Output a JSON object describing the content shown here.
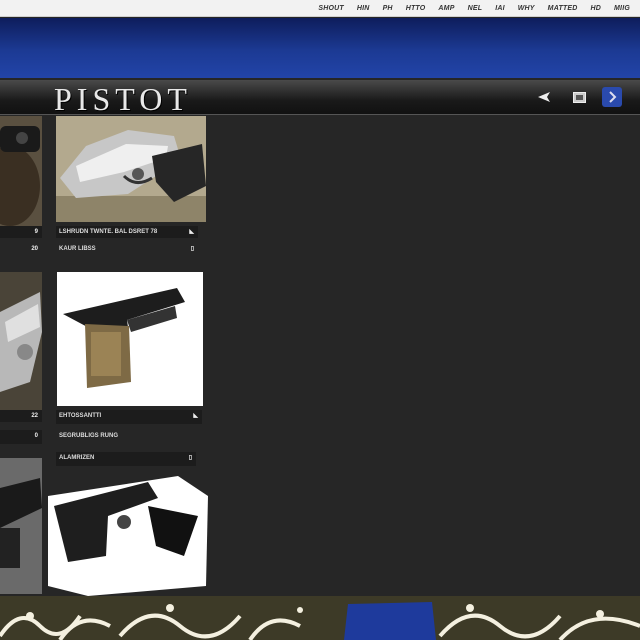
{
  "topnav": [
    "SHOUT",
    "HIN",
    "PH",
    "HTTO",
    "AMP",
    "NEL",
    "IAI",
    "WHY",
    "MATTED",
    "HD",
    "MIIG"
  ],
  "header": {
    "logo_text": "PISTOT"
  },
  "icons": {
    "share": "share-arrow-icon",
    "window": "window-icon",
    "blue": "blue-square-icon"
  },
  "side_labels": [
    "9",
    "20",
    "22",
    "0"
  ],
  "cards": [
    {
      "title": "LSHRUDN TWNTE. BAL DSRET 78",
      "subtitle": "KAUR LIBSS"
    },
    {
      "title": "EHTOSSANTTI",
      "subtitle": "SEGRUBLIGS RUNG",
      "extra": "ALAMRIZEN"
    }
  ],
  "colors": {
    "banner": "#1c3a94",
    "body": "#262626",
    "accent": "#2a4aad",
    "footer": "#4a4630"
  }
}
